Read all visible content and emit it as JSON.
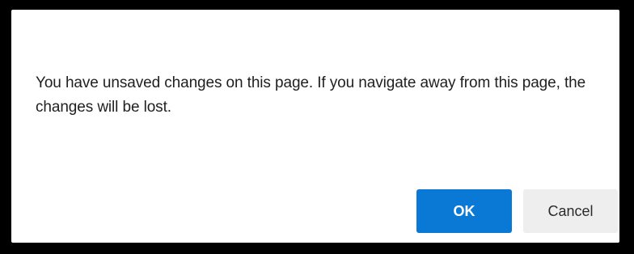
{
  "dialog": {
    "message": "You have unsaved changes on this page. If you navigate away from this page, the changes will be lost.",
    "ok_label": "OK",
    "cancel_label": "Cancel"
  },
  "colors": {
    "primary_button": "#0a79d6",
    "secondary_button": "#eeeeee",
    "frame": "#000000"
  }
}
